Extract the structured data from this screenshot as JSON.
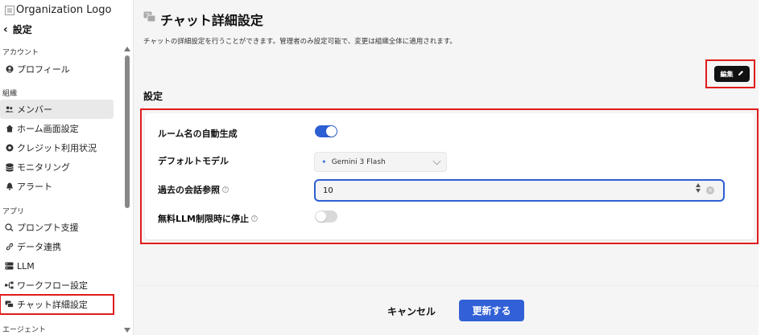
{
  "sidebar": {
    "logo_alt": "Organization Logo",
    "back_label": "設定",
    "sections": {
      "account": "アカウント",
      "org": "組織",
      "app": "アプリ",
      "agent": "エージェント"
    },
    "items": [
      {
        "label": "プロフィール",
        "icon": "user-circle-icon"
      },
      {
        "label": "メンバー",
        "icon": "people-icon"
      },
      {
        "label": "ホーム画面設定",
        "icon": "home-icon"
      },
      {
        "label": "クレジット利用状況",
        "icon": "credit-icon"
      },
      {
        "label": "モニタリング",
        "icon": "database-icon"
      },
      {
        "label": "アラート",
        "icon": "bell-icon"
      },
      {
        "label": "プロンプト支援",
        "icon": "prompt-icon"
      },
      {
        "label": "データ連携",
        "icon": "link-icon"
      },
      {
        "label": "LLM",
        "icon": "server-icon"
      },
      {
        "label": "ワークフロー設定",
        "icon": "workflow-icon"
      },
      {
        "label": "チャット詳細設定",
        "icon": "chat-icon"
      }
    ]
  },
  "main": {
    "title": "チャット詳細設定",
    "description": "チャットの詳細設定を行うことができます。管理者のみ設定可能で、変更は組織全体に適用されます。",
    "edit_label": "編集",
    "section_title": "設定",
    "settings": {
      "auto_room_name": {
        "label": "ルーム名の自動生成",
        "enabled": true
      },
      "default_model": {
        "label": "デフォルトモデル",
        "value": "Gemini 3 Flash"
      },
      "history_ref": {
        "label": "過去の会話参照",
        "value": "10"
      },
      "stop_on_free_limit": {
        "label": "無料LLM制限時に停止",
        "enabled": false
      }
    },
    "footer": {
      "cancel_label": "キャンセル",
      "update_label": "更新する"
    }
  },
  "colors": {
    "accent": "#3260d6",
    "highlight": "#e11b1b",
    "edit_button": "#111111"
  }
}
